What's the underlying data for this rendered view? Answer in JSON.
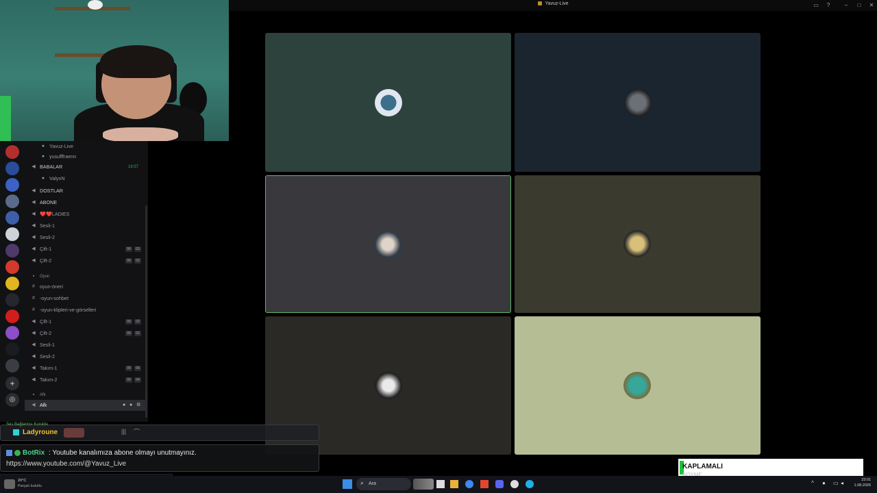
{
  "window": {
    "title": "Yavuz-Live"
  },
  "sidebar": {
    "rows": [
      {
        "type": "user",
        "label": "Yavuz-Live",
        "icon": "avatar-icon"
      },
      {
        "type": "user",
        "label": "yusufffraenn",
        "icon": "avatar-icon"
      },
      {
        "type": "voice",
        "label": "BABALAR",
        "icon": "speaker-icon",
        "time": "16:57"
      },
      {
        "type": "user",
        "label": "ValynN",
        "icon": "avatar-icon"
      },
      {
        "type": "voice",
        "label": "DOSTLAR",
        "icon": "speaker-icon"
      },
      {
        "type": "voice",
        "label": "ABONE",
        "icon": "speaker-icon"
      },
      {
        "type": "voice",
        "label": "❤️❤️LADIES",
        "icon": "speaker-icon"
      },
      {
        "type": "voice",
        "label": "Sesli-1",
        "icon": "speaker-icon"
      },
      {
        "type": "voice",
        "label": "Sesli-2",
        "icon": "speaker-icon"
      },
      {
        "type": "voice",
        "label": "Çift-1",
        "icon": "speaker-icon",
        "count": "00",
        "limit": "03"
      },
      {
        "type": "voice",
        "label": "Çift-2",
        "icon": "speaker-icon",
        "count": "00",
        "limit": "02"
      },
      {
        "type": "category",
        "label": "Oyun"
      },
      {
        "type": "text",
        "label": "oyun-öneri",
        "icon": "hash-icon"
      },
      {
        "type": "text",
        "label": "-oyun-sohbet",
        "icon": "hash-icon"
      },
      {
        "type": "text",
        "label": "-oyun-klipleri-ve-görselleri",
        "icon": "hash-icon"
      },
      {
        "type": "voice",
        "label": "Çift-1",
        "icon": "speaker-icon",
        "count": "00",
        "limit": "02"
      },
      {
        "type": "voice",
        "label": "Çift-2",
        "icon": "speaker-icon",
        "count": "00",
        "limit": "02"
      },
      {
        "type": "voice",
        "label": "Sesli-1",
        "icon": "speaker-icon"
      },
      {
        "type": "voice",
        "label": "Sesli-2",
        "icon": "speaker-icon"
      },
      {
        "type": "voice",
        "label": "Takım-1",
        "icon": "speaker-icon",
        "count": "00",
        "limit": "06"
      },
      {
        "type": "voice",
        "label": "Takım-2",
        "icon": "speaker-icon",
        "count": "00",
        "limit": "04"
      },
      {
        "type": "category",
        "label": "Afk"
      },
      {
        "type": "voice",
        "label": "Afk",
        "icon": "speaker-icon",
        "active": true
      }
    ]
  },
  "chat": {
    "line1": {
      "user": "Ladyroune",
      "connection": "Ses Bağlantısı Kuruldu"
    },
    "line2": {
      "user": "BotRix",
      "message": "Youtube kanalımıza abone olmayı unutmayınız.",
      "link": "https://www.youtube.com/@Yavuz_Live"
    }
  },
  "overlay": {
    "text": "KAPLAMALI",
    "sub": "BOYME"
  },
  "taskbar": {
    "search": "Ara",
    "weather_temp": "20°C",
    "weather_desc": "Parçalı bulutlu",
    "clock_time": "23:01",
    "clock_date": "1.08.2026"
  },
  "colors": {
    "tile1": "#2d423c",
    "tile2": "#1b2530",
    "tile3": "#39393d",
    "tile4": "#3a3a2f",
    "tile5": "#2a2925",
    "tile6": "#b5bd95",
    "speaking": "#5fb86a",
    "accent": "#5865f2"
  }
}
